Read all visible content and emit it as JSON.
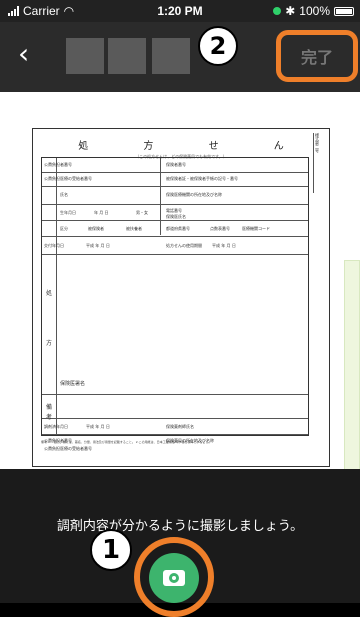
{
  "status_bar": {
    "carrier": "Carrier",
    "time": "1:20 PM",
    "battery": "100%"
  },
  "header": {
    "done_label": "完了",
    "step_badge": "2"
  },
  "document": {
    "title": "処 方 せ ん",
    "subtitle": "（この処方せんは、どの保険薬局でも有効です。）",
    "section_labels": [
      "処",
      "方",
      "備",
      "考"
    ],
    "field_labels": {
      "insurer_number": "保険者番号",
      "public_number": "公費負担者番号",
      "recipient_number": "公費負担医療の受給者番号",
      "card_number": "被保険者証・被保険者手帳の記号・番号",
      "name": "氏名",
      "birth": "生年月日",
      "birth_values": "年 月 日",
      "sex": "男・女",
      "category": "区分",
      "insured": "被保険者",
      "dependent": "被扶養者",
      "institution": "保険医療機関の所在地及び名称",
      "phone": "電話番号",
      "doctor": "保険医氏名",
      "prefecture_code": "都道府県番号",
      "point_table": "点数表番号",
      "institution_code": "医療機関コード",
      "issue_date": "交付年月日",
      "issue_values": "平成 年 月 日",
      "expiry": "処方せんの使用期間",
      "expiry_values": "平成 年 月 日",
      "insurer_signature": "保険医署名",
      "dispense_date": "調剤済年月日",
      "dispense_values": "平成 年 月 日",
      "pharmacy": "保険薬局の所在地及び名称",
      "pharmacist": "保険薬剤師氏名",
      "public_number_2": "公費負担者番号",
      "recipient_number_2": "公費負担医療の受給者番号",
      "form_label": "様式第二号"
    },
    "notes": "備考 1.「処方」欄には、薬名、分量、用法及び用量を記載すること。 2.この用紙は、日本工業規格A列5番を標準とすること。"
  },
  "bottom": {
    "hint": "調剤内容が分かるように撮影しましょう。",
    "step_badge": "1"
  },
  "colors": {
    "accent_orange": "#ef7f2a",
    "shutter_green": "#3db46d"
  }
}
